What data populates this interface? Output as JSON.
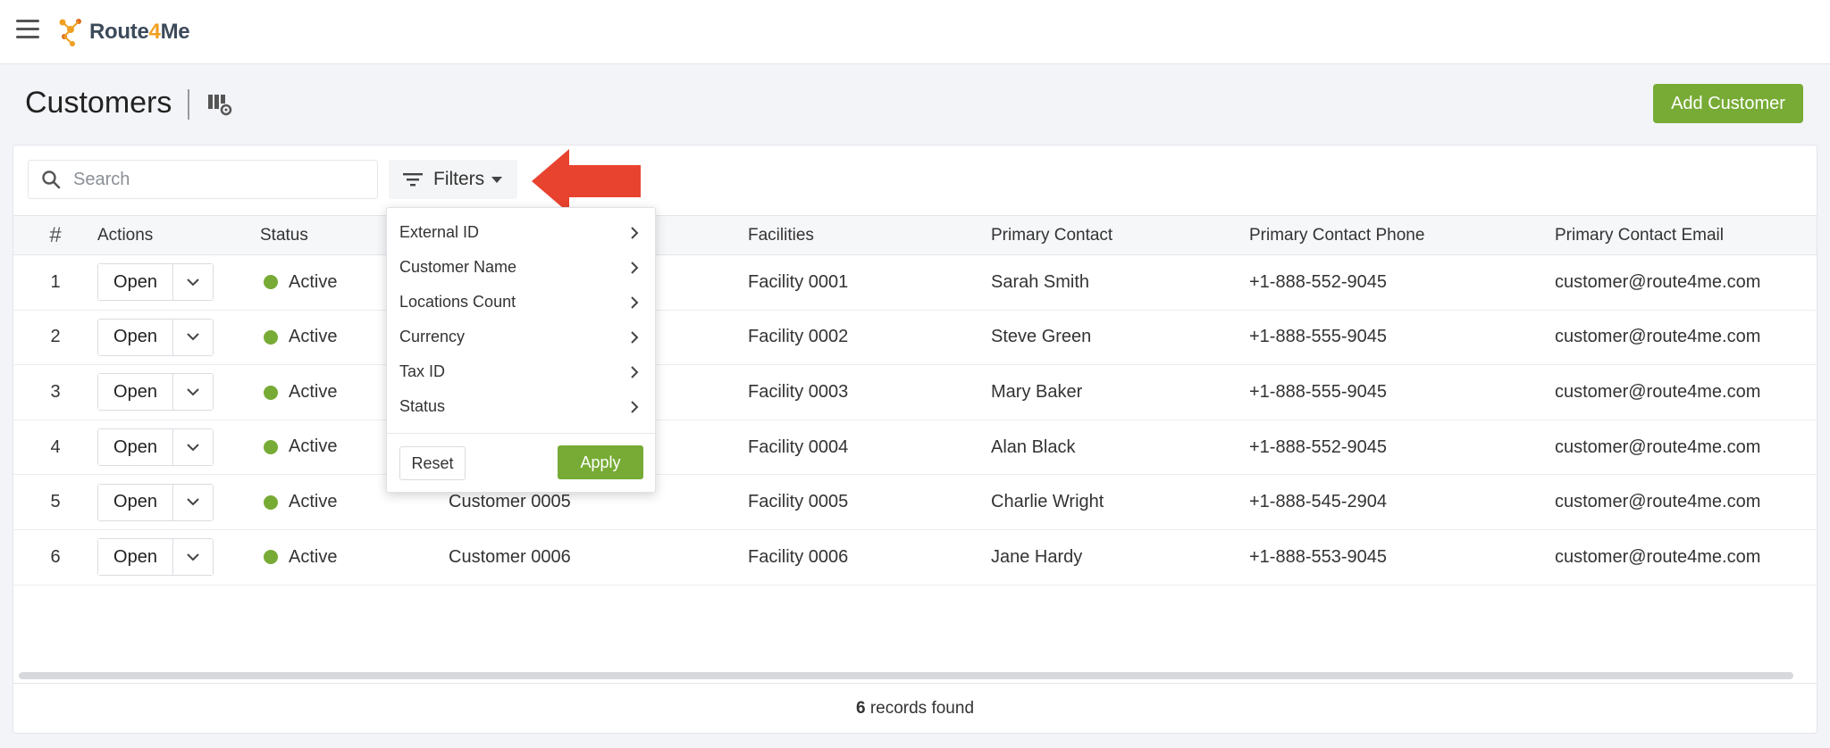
{
  "app": {
    "logo_text_a": "Route",
    "logo_text_b": "4",
    "logo_text_c": "Me"
  },
  "header": {
    "title": "Customers",
    "add_button": "Add Customer"
  },
  "toolbar": {
    "search_placeholder": "Search",
    "filters_label": "Filters"
  },
  "colors": {
    "accent_green": "#77ab35",
    "status_active": "#77ab35",
    "arrow_red": "#e8432f"
  },
  "table": {
    "columns": [
      "#",
      "Actions",
      "Status",
      "",
      "Facilities",
      "Primary Contact",
      "Primary Contact Phone",
      "Primary Contact Email"
    ],
    "open_label": "Open",
    "rows": [
      {
        "num": "1",
        "status": "Active",
        "customer": "",
        "facility": "Facility 0001",
        "contact": "Sarah Smith",
        "phone": "+1-888-552-9045",
        "email": "customer@route4me.com"
      },
      {
        "num": "2",
        "status": "Active",
        "customer": "",
        "facility": "Facility 0002",
        "contact": "Steve Green",
        "phone": "+1-888-555-9045",
        "email": "customer@route4me.com"
      },
      {
        "num": "3",
        "status": "Active",
        "customer": "",
        "facility": "Facility 0003",
        "contact": "Mary Baker",
        "phone": "+1-888-555-9045",
        "email": "customer@route4me.com"
      },
      {
        "num": "4",
        "status": "Active",
        "customer": "",
        "facility": "Facility 0004",
        "contact": "Alan Black",
        "phone": "+1-888-552-9045",
        "email": "customer@route4me.com"
      },
      {
        "num": "5",
        "status": "Active",
        "customer": "Customer 0005",
        "facility": "Facility 0005",
        "contact": "Charlie Wright",
        "phone": "+1-888-545-2904",
        "email": "customer@route4me.com"
      },
      {
        "num": "6",
        "status": "Active",
        "customer": "Customer 0006",
        "facility": "Facility 0006",
        "contact": "Jane Hardy",
        "phone": "+1-888-553-9045",
        "email": "customer@route4me.com"
      }
    ]
  },
  "footer": {
    "count": "6",
    "suffix": " records found"
  },
  "filter_menu": {
    "items": [
      "External ID",
      "Customer Name",
      "Locations Count",
      "Currency",
      "Tax ID",
      "Status"
    ],
    "reset_label": "Reset",
    "apply_label": "Apply"
  }
}
